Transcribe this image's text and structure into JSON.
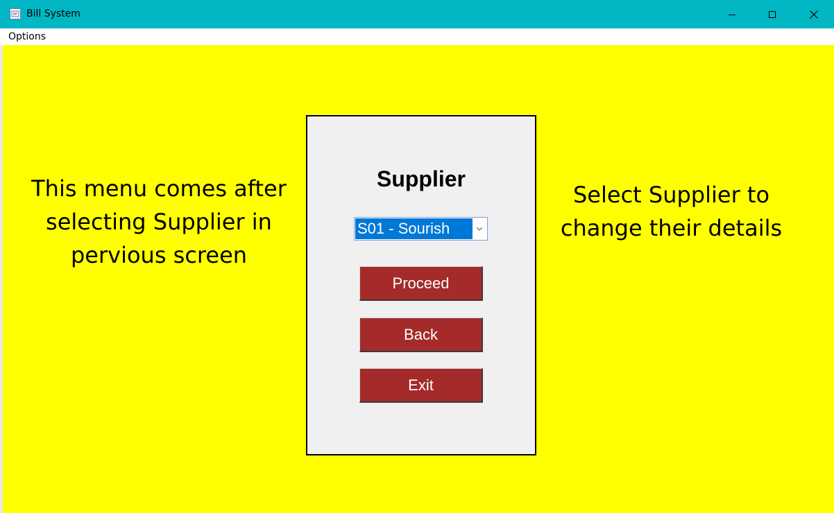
{
  "window": {
    "title": "Bill System",
    "app_icon": "bill-system-app-icon",
    "controls": [
      "minimize-icon",
      "maximize-icon",
      "close-icon"
    ],
    "titlebar_color": "#00b7c3"
  },
  "menubar": {
    "items": [
      {
        "label": "Options"
      }
    ]
  },
  "left_note": "This menu comes after\nselecting Supplier in\npervious screen",
  "right_note": "Select Supplier to\nchange their details",
  "panel": {
    "title": "Supplier",
    "supplier_select": {
      "selected": "S01 - Sourish"
    },
    "buttons": {
      "proceed": "Proceed",
      "back": "Back",
      "exit": "Exit"
    }
  },
  "colors": {
    "background": "#ffff00",
    "panel": "#f0f0f0",
    "button": "#a52a2a",
    "selection": "#0078d7"
  }
}
